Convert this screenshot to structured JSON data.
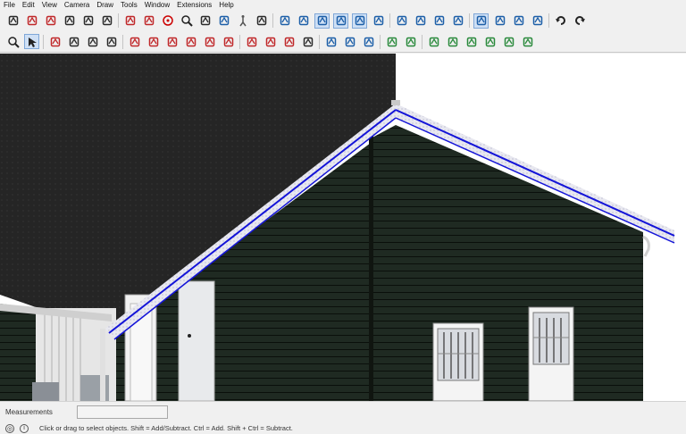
{
  "menu": [
    "File",
    "Edit",
    "View",
    "Camera",
    "Draw",
    "Tools",
    "Window",
    "Extensions",
    "Help"
  ],
  "toolbar1": [
    "paint-icon",
    "move-icon",
    "rotate-icon",
    "text-icon",
    "axes-icon",
    "3d-text-icon",
    "separator",
    "section-plane-icon",
    "section-cut-icon",
    "orbit-icon",
    "zoom-icon",
    "zoom-extents-icon",
    "previous-view-icon",
    "walk-icon",
    "look-around-icon",
    "separator",
    "iso-view-icon",
    "top-view-icon",
    "front-view-icon",
    "right-view-icon",
    "back-view-icon",
    "left-view-icon",
    "separator",
    "position-camera-icon",
    "xray-icon",
    "back-edges-icon",
    "wireframe-icon",
    "separator",
    "hidden-line-icon",
    "shaded-icon",
    "shaded-textures-icon",
    "monochrome-icon",
    "separator",
    "undo-icon",
    "redo-icon"
  ],
  "toolbar1_active": [
    18,
    19,
    20,
    28
  ],
  "toolbar2": [
    "zoom-window-icon",
    "select-icon",
    "separator",
    "eraser-icon",
    "pencil-icon",
    "arc-icon",
    "rectangle-icon",
    "separator",
    "push-pull-icon",
    "follow-me-icon",
    "move-icon",
    "rotate-icon",
    "scale-icon",
    "offset-icon",
    "separator",
    "tape-measure-icon",
    "dimension-icon",
    "protractor-icon",
    "text-icon",
    "separator",
    "solid-tools-icon",
    "sandbox-icon",
    "layers-icon",
    "separator",
    "component-icon",
    "user-icon",
    "separator",
    "dynamic-component-icon",
    "extension-icon",
    "ruby-icon",
    "warehouse-icon",
    "outliner-icon",
    "scenes-icon"
  ],
  "toolbar2_active": [
    1
  ],
  "measurements": {
    "label": "Measurements",
    "value": ""
  },
  "status": {
    "hint": "Click or drag to select objects. Shift = Add/Subtract. Ctrl = Add. Shift + Ctrl = Subtract.",
    "geo_icon": "geo-location-icon",
    "info_icon": "info-icon"
  },
  "colors": {
    "siding": "#1f2a22",
    "roof": "#232323",
    "fascia_highlight": "#1414d8",
    "trim": "#d0d0d0"
  }
}
